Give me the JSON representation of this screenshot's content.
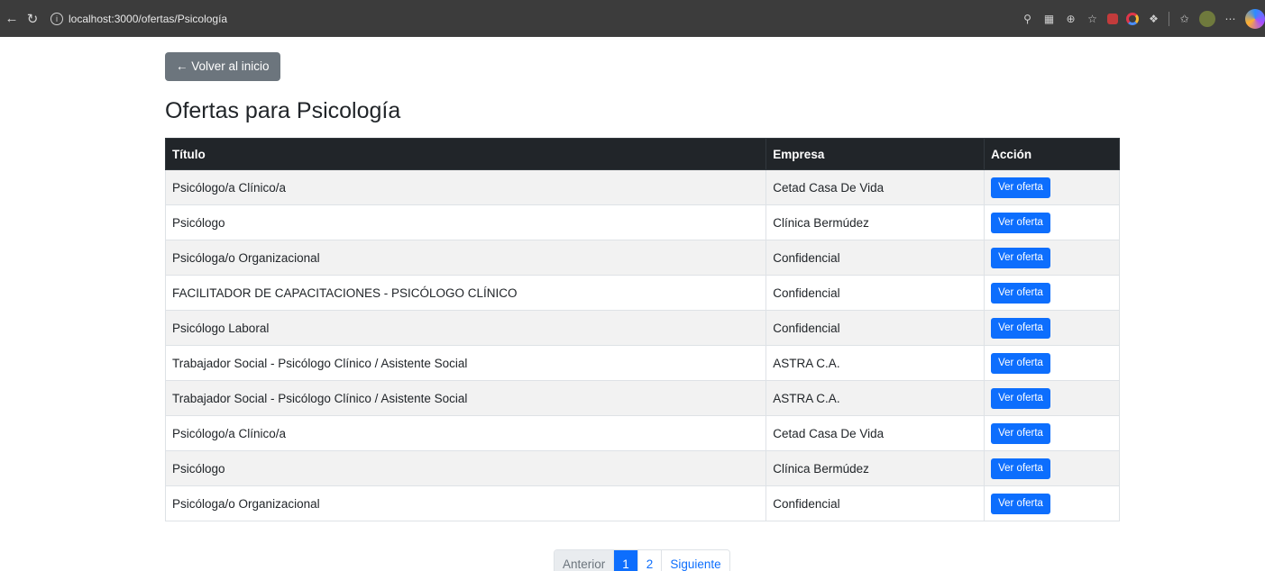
{
  "browser": {
    "url": "localhost:3000/ofertas/Psicología"
  },
  "page": {
    "back_label": "← Volver al inicio",
    "title": "Ofertas para Psicología"
  },
  "table": {
    "headers": [
      "Título",
      "Empresa",
      "Acción"
    ],
    "rows": [
      {
        "title": "Psicólogo/a Clínico/a",
        "company": "Cetad Casa De Vida",
        "action": "Ver oferta"
      },
      {
        "title": "Psicólogo",
        "company": "Clínica Bermúdez",
        "action": "Ver oferta"
      },
      {
        "title": "Psicóloga/o Organizacional",
        "company": "Confidencial",
        "action": "Ver oferta"
      },
      {
        "title": "FACILITADOR DE CAPACITACIONES - PSICÓLOGO CLÍNICO",
        "company": "Confidencial",
        "action": "Ver oferta"
      },
      {
        "title": "Psicólogo Laboral",
        "company": "Confidencial",
        "action": "Ver oferta"
      },
      {
        "title": "Trabajador Social - Psicólogo Clínico / Asistente Social",
        "company": "ASTRA C.A.",
        "action": "Ver oferta"
      },
      {
        "title": "Trabajador Social - Psicólogo Clínico / Asistente Social",
        "company": "ASTRA C.A.",
        "action": "Ver oferta"
      },
      {
        "title": "Psicólogo/a Clínico/a",
        "company": "Cetad Casa De Vida",
        "action": "Ver oferta"
      },
      {
        "title": "Psicólogo",
        "company": "Clínica Bermúdez",
        "action": "Ver oferta"
      },
      {
        "title": "Psicóloga/o Organizacional",
        "company": "Confidencial",
        "action": "Ver oferta"
      }
    ]
  },
  "pagination": {
    "prev": "Anterior",
    "pages": [
      "1",
      "2"
    ],
    "current": "1",
    "next": "Siguiente"
  },
  "colors": {
    "primary": "#0d6efd",
    "secondary": "#6c757d",
    "dark": "#212529",
    "chrome": "#3c3c3c"
  }
}
